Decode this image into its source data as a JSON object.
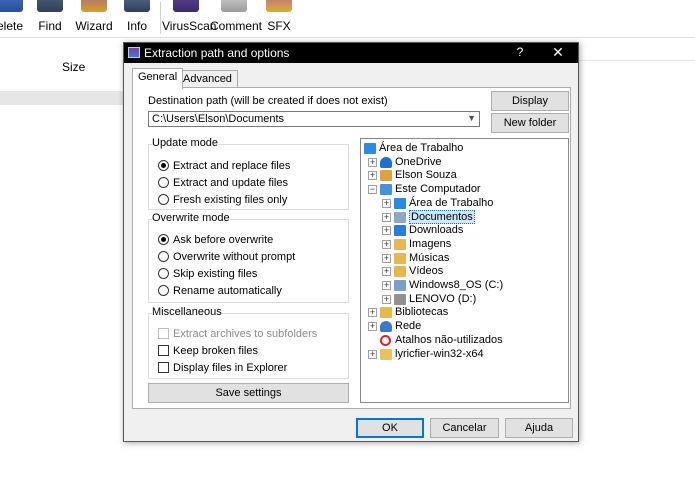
{
  "toolbar": {
    "items": [
      {
        "label": "elete",
        "icon": "delete-icon"
      },
      {
        "label": "Find",
        "icon": "find-icon"
      },
      {
        "label": "Wizard",
        "icon": "wizard-icon"
      },
      {
        "label": "Info",
        "icon": "info-icon"
      },
      {
        "label": "VirusScan",
        "icon": "virusscan-icon"
      },
      {
        "label": "Comment",
        "icon": "comment-icon"
      },
      {
        "label": "SFX",
        "icon": "sfx-icon"
      }
    ]
  },
  "file_list": {
    "size_header": "Size"
  },
  "dialog": {
    "title": "Extraction path and options",
    "help": "?",
    "close": "✕",
    "tabs": [
      {
        "label": "General",
        "active": true
      },
      {
        "label": "Advanced",
        "active": false
      }
    ],
    "destination_label": "Destination path (will be created if does not exist)",
    "destination_value": "C:\\Users\\Elson\\Documents",
    "display_button": "Display",
    "new_folder_button": "New folder",
    "update_mode": {
      "title": "Update mode",
      "options": [
        {
          "label": "Extract and replace files",
          "selected": true
        },
        {
          "label": "Extract and update files",
          "selected": false
        },
        {
          "label": "Fresh existing files only",
          "selected": false
        }
      ]
    },
    "overwrite_mode": {
      "title": "Overwrite mode",
      "options": [
        {
          "label": "Ask before overwrite",
          "selected": true
        },
        {
          "label": "Overwrite without prompt",
          "selected": false
        },
        {
          "label": "Skip existing files",
          "selected": false
        },
        {
          "label": "Rename automatically",
          "selected": false
        }
      ]
    },
    "miscellaneous": {
      "title": "Miscellaneous",
      "options": [
        {
          "label": "Extract archives to subfolders",
          "checked": false,
          "disabled": true
        },
        {
          "label": "Keep broken files",
          "checked": false,
          "disabled": false
        },
        {
          "label": "Display files in Explorer",
          "checked": false,
          "disabled": false
        }
      ]
    },
    "save_settings_button": "Save settings",
    "tree": [
      {
        "label": "Área de Trabalho",
        "level": 0,
        "expander": "",
        "icon": "desktop-folder-icon",
        "color": "#2b8be0"
      },
      {
        "label": "OneDrive",
        "level": 1,
        "expander": "+",
        "icon": "onedrive-icon",
        "color": "#1e6fd0"
      },
      {
        "label": "Elson Souza",
        "level": 1,
        "expander": "+",
        "icon": "user-folder-icon",
        "color": "#e0a040"
      },
      {
        "label": "Este Computador",
        "level": 1,
        "expander": "−",
        "icon": "computer-icon",
        "color": "#4a90d9"
      },
      {
        "label": "Área de Trabalho",
        "level": 2,
        "expander": "+",
        "icon": "desktop-folder-icon",
        "color": "#2b8be0"
      },
      {
        "label": "Documentos",
        "level": 2,
        "expander": "+",
        "icon": "documents-icon",
        "color": "#8fa8c8",
        "selected": true
      },
      {
        "label": "Downloads",
        "level": 2,
        "expander": "+",
        "icon": "downloads-icon",
        "color": "#2a7fd4"
      },
      {
        "label": "Imagens",
        "level": 2,
        "expander": "+",
        "icon": "pictures-icon",
        "color": "#e6b84d"
      },
      {
        "label": "Músicas",
        "level": 2,
        "expander": "+",
        "icon": "music-icon",
        "color": "#e6b84d"
      },
      {
        "label": "Vídeos",
        "level": 2,
        "expander": "+",
        "icon": "videos-icon",
        "color": "#e6b84d"
      },
      {
        "label": "Windows8_OS (C:)",
        "level": 2,
        "expander": "+",
        "icon": "drive-c-icon",
        "color": "#7aa0c8"
      },
      {
        "label": "LENOVO (D:)",
        "level": 2,
        "expander": "+",
        "icon": "drive-d-icon",
        "color": "#909090"
      },
      {
        "label": "Bibliotecas",
        "level": 1,
        "expander": "+",
        "icon": "libraries-icon",
        "color": "#e6b84d"
      },
      {
        "label": "Rede",
        "level": 1,
        "expander": "+",
        "icon": "network-icon",
        "color": "#3a7ac8"
      },
      {
        "label": "Atalhos não-utilizados",
        "level": 1,
        "expander": "",
        "icon": "unused-shortcuts-icon",
        "color": "#d9232b"
      },
      {
        "label": "lyricfier-win32-x64",
        "level": 1,
        "expander": "+",
        "icon": "folder-icon",
        "color": "#e6c35c"
      }
    ],
    "ok_button": "OK",
    "cancel_button": "Cancelar",
    "help_button": "Ajuda"
  },
  "colors": {
    "titlebar": "#000000",
    "dialog_bg": "#f0f0f0",
    "selection": "#cce8ff",
    "focus_border": "#0078d7"
  }
}
